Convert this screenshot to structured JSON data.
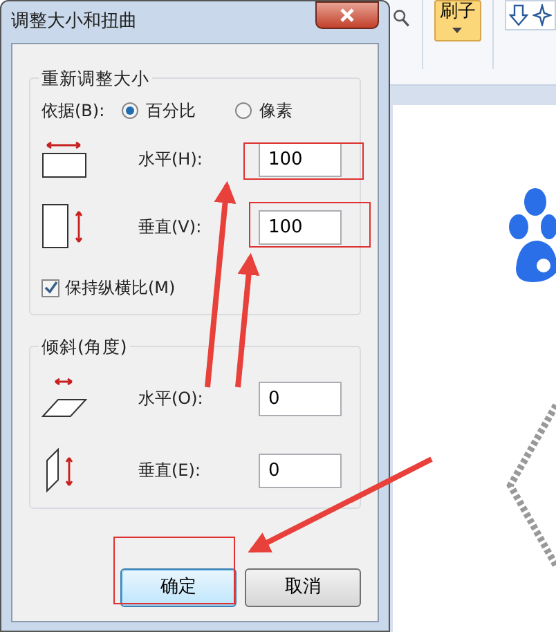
{
  "dialog": {
    "title": "调整大小和扭曲",
    "resize_group": {
      "title": "重新调整大小",
      "by_label": "依据(B):",
      "options": [
        {
          "label": "百分比",
          "selected": true
        },
        {
          "label": "像素",
          "selected": false
        }
      ],
      "fields": [
        {
          "label": "水平(H):",
          "value": "100"
        },
        {
          "label": "垂直(V):",
          "value": "100"
        }
      ],
      "keep_ratio": {
        "label": "保持纵横比(M)",
        "checked": true
      }
    },
    "skew_group": {
      "title": "倾斜(角度)",
      "fields": [
        {
          "label": "水平(O):",
          "value": "0"
        },
        {
          "label": "垂直(E):",
          "value": "0"
        }
      ]
    },
    "buttons": [
      {
        "label": "确定",
        "default": true
      },
      {
        "label": "取消",
        "default": false
      }
    ]
  },
  "ribbon": {
    "brush_button": {
      "label": "刷子",
      "selected": true
    }
  }
}
